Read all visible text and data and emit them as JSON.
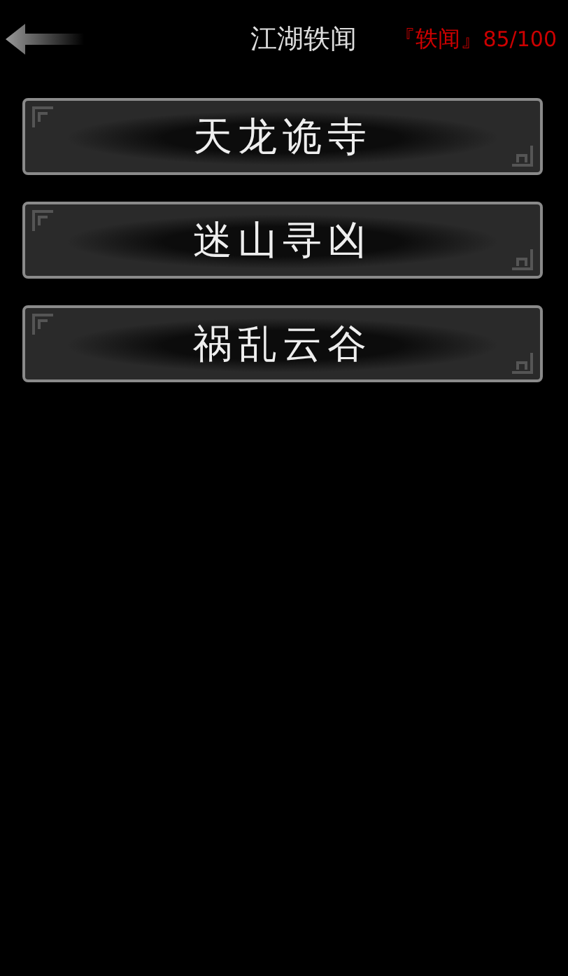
{
  "header": {
    "title": "江湖轶闻",
    "tag": "『轶闻』",
    "count": "85/100"
  },
  "stories": [
    {
      "label": "天龙诡寺"
    },
    {
      "label": "迷山寻凶"
    },
    {
      "label": "祸乱云谷"
    }
  ]
}
